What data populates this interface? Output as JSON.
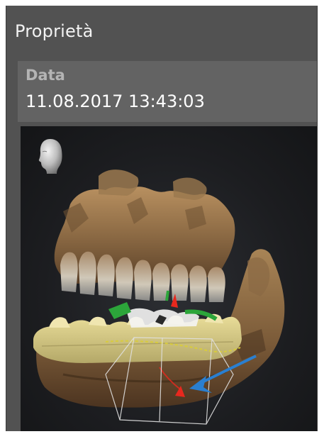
{
  "panel": {
    "title": "Proprietà"
  },
  "date": {
    "label": "Data",
    "value": "11.08.2017 13:43:03"
  },
  "viewer": {
    "orientation_icon": "head-orientation-icon",
    "annotation_colors": {
      "arrow": "#2a7fd0",
      "marker": "#e8281e",
      "guide": "#2ca53a",
      "frame": "#e0e0e0",
      "spline": "#d8cc3c"
    }
  }
}
